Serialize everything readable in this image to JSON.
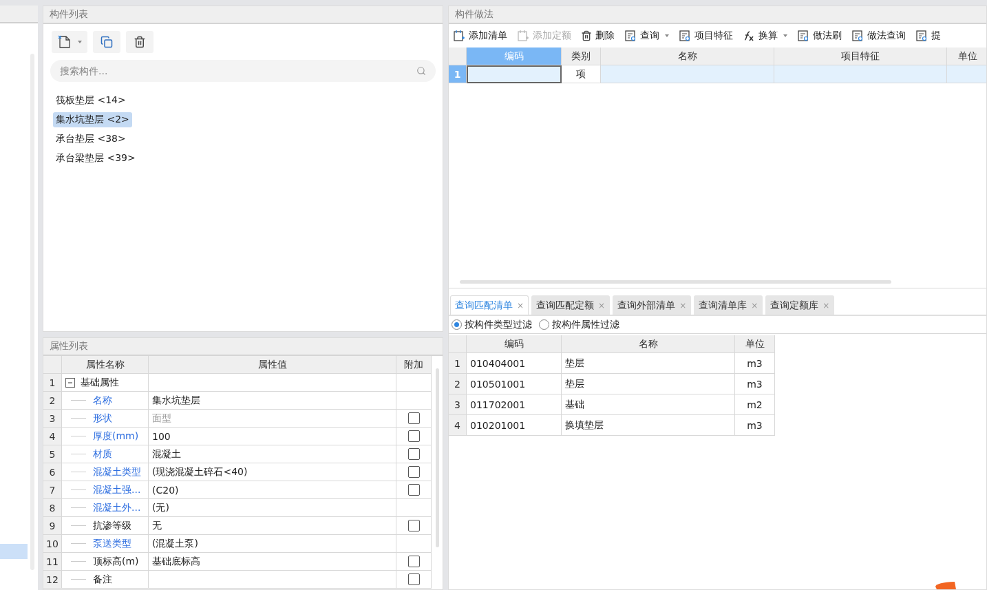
{
  "component_list": {
    "title": "构件列表",
    "search": {
      "placeholder": "搜索构件..."
    },
    "items": [
      {
        "label": "筏板垫层 <14>",
        "selected": false
      },
      {
        "label": "集水坑垫层 <2>",
        "selected": true
      },
      {
        "label": "承台垫层 <38>",
        "selected": false
      },
      {
        "label": "承台梁垫层 <39>",
        "selected": false
      }
    ]
  },
  "property_list": {
    "title": "属性列表",
    "columns": [
      "属性名称",
      "属性值",
      "附加"
    ],
    "rows": [
      {
        "number": "1",
        "name": "基础属性",
        "kind": "group",
        "expanded": true,
        "checkbox": false
      },
      {
        "number": "2",
        "name": "名称",
        "value": "集水坑垫层",
        "kind": "item",
        "linked": true,
        "disabled": false,
        "checkbox": false
      },
      {
        "number": "3",
        "name": "形状",
        "value": "面型",
        "kind": "item",
        "linked": true,
        "disabled": true,
        "checkbox": true,
        "checked": false
      },
      {
        "number": "4",
        "name": "厚度(mm)",
        "value": "100",
        "kind": "item",
        "linked": true,
        "disabled": false,
        "checkbox": true,
        "checked": false
      },
      {
        "number": "5",
        "name": "材质",
        "value": "混凝土",
        "kind": "item",
        "linked": true,
        "disabled": false,
        "checkbox": true,
        "checked": false
      },
      {
        "number": "6",
        "name": "混凝土类型",
        "value": "(现浇混凝土碎石<40)",
        "kind": "item",
        "linked": true,
        "disabled": false,
        "checkbox": true,
        "checked": false
      },
      {
        "number": "7",
        "name": "混凝土强...",
        "value": "(C20)",
        "kind": "item",
        "linked": true,
        "disabled": false,
        "checkbox": true,
        "checked": false
      },
      {
        "number": "8",
        "name": "混凝土外...",
        "value": "(无)",
        "kind": "item",
        "linked": true,
        "disabled": false,
        "checkbox": false
      },
      {
        "number": "9",
        "name": "抗渗等级",
        "value": "无",
        "kind": "item",
        "linked": false,
        "disabled": false,
        "checkbox": true,
        "checked": false
      },
      {
        "number": "10",
        "name": "泵送类型",
        "value": "(混凝土泵)",
        "kind": "item",
        "linked": true,
        "disabled": false,
        "checkbox": false
      },
      {
        "number": "11",
        "name": "顶标高(m)",
        "value": "基础底标高",
        "kind": "item",
        "linked": false,
        "disabled": false,
        "checkbox": true,
        "checked": false
      },
      {
        "number": "12",
        "name": "备注",
        "kind": "item",
        "linked": false,
        "checkbox": true,
        "checked": false
      }
    ]
  },
  "method": {
    "title": "构件做法",
    "toolbar": [
      {
        "label": "添加清单",
        "kind": "add-list",
        "disabled": false,
        "dropdown": false
      },
      {
        "label": "添加定额",
        "kind": "add-quota",
        "disabled": true,
        "dropdown": false
      },
      {
        "label": "删除",
        "kind": "delete",
        "disabled": false,
        "dropdown": false
      },
      {
        "label": "查询",
        "kind": "query",
        "disabled": false,
        "dropdown": true
      },
      {
        "label": "项目特征",
        "kind": "feature",
        "disabled": false,
        "dropdown": false
      },
      {
        "label": "换算",
        "kind": "formula",
        "disabled": false,
        "dropdown": true
      },
      {
        "label": "做法刷",
        "kind": "brush",
        "disabled": false,
        "dropdown": false
      },
      {
        "label": "做法查询",
        "kind": "query",
        "disabled": false,
        "dropdown": false
      },
      {
        "label": "提",
        "kind": "extract",
        "disabled": false,
        "dropdown": false
      }
    ],
    "columns": [
      {
        "label": "编码",
        "selected": true
      },
      {
        "label": "类别",
        "selected": false
      },
      {
        "label": "名称",
        "selected": false
      },
      {
        "label": "项目特征",
        "selected": false
      },
      {
        "label": "单位",
        "selected": false
      }
    ],
    "rows": [
      {
        "number": "1",
        "selected": true,
        "category": "项"
      }
    ]
  },
  "query_tabs": [
    {
      "label": "查询匹配清单",
      "close": "×",
      "selected": true
    },
    {
      "label": "查询匹配定额",
      "close": "×",
      "selected": false
    },
    {
      "label": "查询外部清单",
      "close": "×",
      "selected": false
    },
    {
      "label": "查询清单库",
      "close": "×",
      "selected": false
    },
    {
      "label": "查询定额库",
      "close": "×",
      "selected": false
    }
  ],
  "filters": [
    {
      "label": "按构件类型过滤",
      "selected": true
    },
    {
      "label": "按构件属性过滤",
      "selected": false
    }
  ],
  "results": {
    "columns": [
      "编码",
      "名称",
      "单位"
    ],
    "rows": [
      {
        "number": "1",
        "code": "010404001",
        "name": "垫层",
        "unit": "m3"
      },
      {
        "number": "2",
        "code": "010501001",
        "name": "垫层",
        "unit": "m3"
      },
      {
        "number": "3",
        "code": "011702001",
        "name": "基础",
        "unit": "m2"
      },
      {
        "number": "4",
        "code": "010201001",
        "name": "换填垫层",
        "unit": "m3"
      }
    ]
  }
}
